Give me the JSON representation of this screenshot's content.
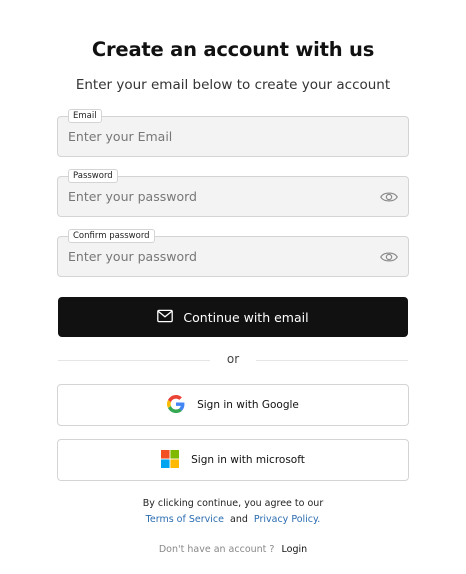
{
  "header": {
    "title": "Create an account with us",
    "subtitle": "Enter your email below to create your account"
  },
  "form": {
    "email": {
      "label": "Email",
      "placeholder": "Enter your Email",
      "value": ""
    },
    "password": {
      "label": "Password",
      "placeholder": "Enter your password",
      "value": "",
      "icon": "eye-icon"
    },
    "confirm_password": {
      "label": "Confirm password",
      "placeholder": "Enter your password",
      "value": "",
      "icon": "eye-icon"
    },
    "submit_label": "Continue with email",
    "submit_icon": "mail-icon"
  },
  "divider": {
    "label": "or"
  },
  "social": {
    "google": {
      "label": "Sign in with Google",
      "icon": "google-icon"
    },
    "microsoft": {
      "label": "Sign in with microsoft",
      "icon": "microsoft-icon"
    }
  },
  "legal": {
    "prefix": "By clicking continue, you agree to our",
    "terms_link": "Terms of Service",
    "and": "and",
    "privacy_link": "Privacy Policy."
  },
  "footer": {
    "prompt": "Don't have an account ?",
    "login_link": "Login"
  },
  "colors": {
    "primary_button": "#111111",
    "link": "#2b6cb0",
    "field_bg": "#f3f3f3",
    "border": "#d4d4d4"
  }
}
